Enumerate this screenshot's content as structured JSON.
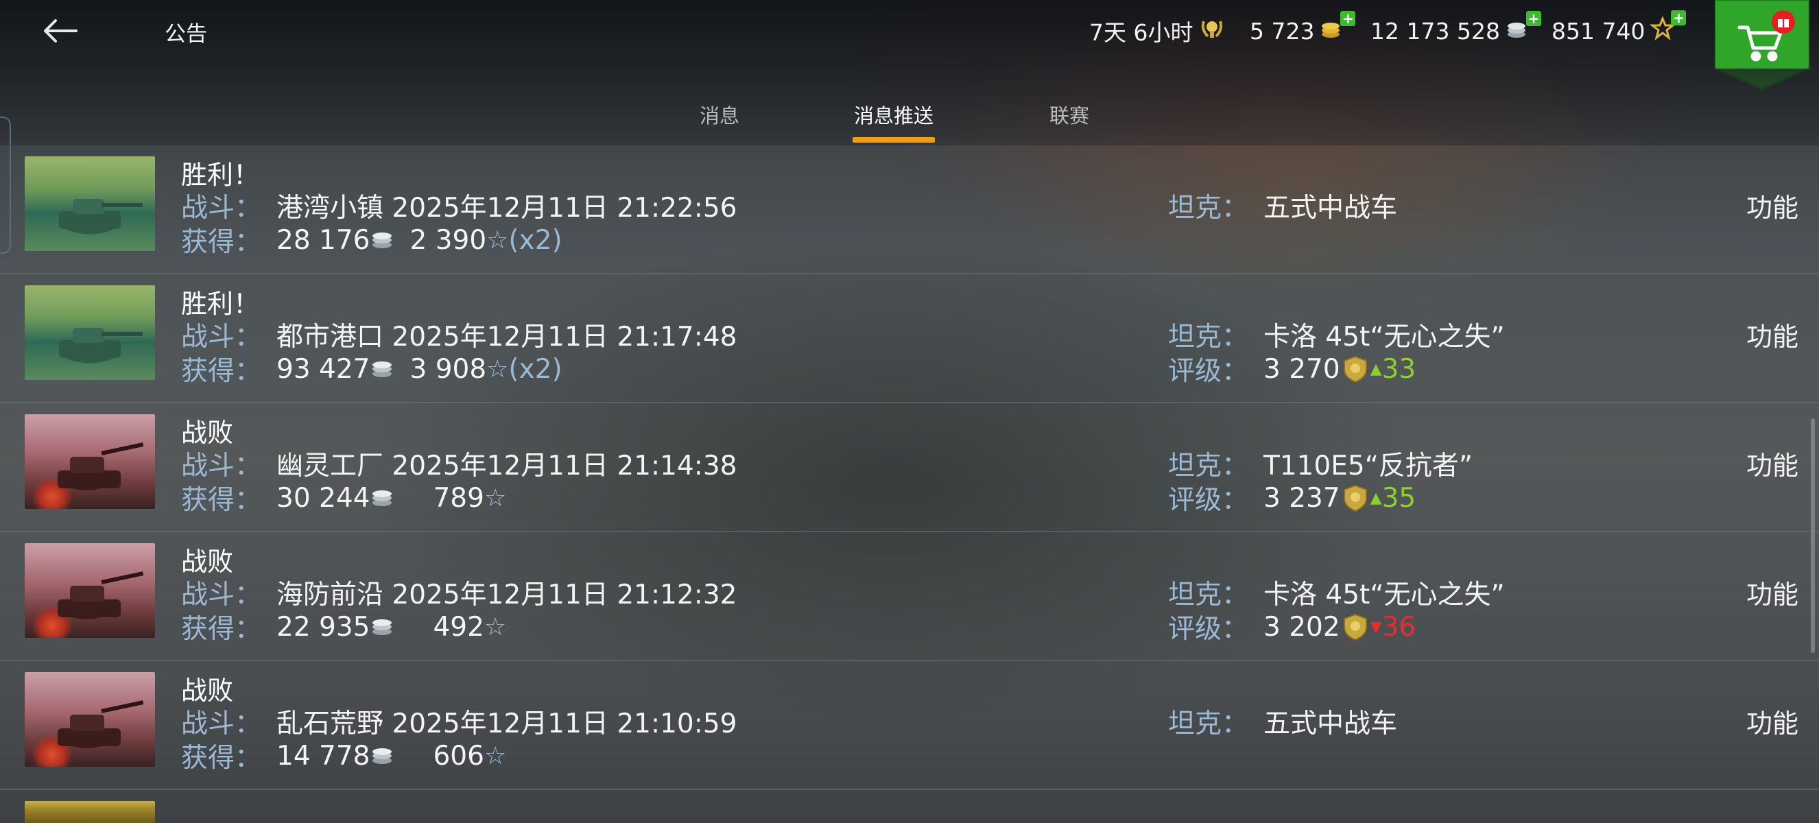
{
  "header": {
    "title": "公告",
    "timer": "7天 6小时",
    "gold": "5 723",
    "credits": "12 173 528",
    "free_xp": "851 740"
  },
  "tabs": [
    {
      "label": "消息",
      "active": false
    },
    {
      "label": "消息推送",
      "active": true
    },
    {
      "label": "联赛",
      "active": false
    }
  ],
  "labels": {
    "battle": "战斗：",
    "earned": "获得：",
    "tank": "坦克：",
    "rating": "评级：",
    "function": "功能"
  },
  "messages": [
    {
      "result": "胜利！",
      "thumb": "win",
      "battle": "港湾小镇 2025年12月11日 21:22:56",
      "credits": "28 176",
      "xp": "2 390",
      "multiplier": "(x2)",
      "tank": "五式中战车",
      "rating": null
    },
    {
      "result": "胜利！",
      "thumb": "win",
      "battle": "都市港口 2025年12月11日 21:17:48",
      "credits": "93 427",
      "xp": "3 908",
      "multiplier": "(x2)",
      "tank": "卡洛 45t“无心之失”",
      "rating": {
        "value": "3 270",
        "delta": "33",
        "direction": "up"
      }
    },
    {
      "result": "战败",
      "thumb": "loss",
      "battle": "幽灵工厂 2025年12月11日 21:14:38",
      "credits": "30 244",
      "xp": "789",
      "multiplier": "",
      "tank": "T110E5“反抗者”",
      "rating": {
        "value": "3 237",
        "delta": "35",
        "direction": "up"
      }
    },
    {
      "result": "战败",
      "thumb": "loss",
      "battle": "海防前沿 2025年12月11日 21:12:32",
      "credits": "22 935",
      "xp": "492",
      "multiplier": "",
      "tank": "卡洛 45t“无心之失”",
      "rating": {
        "value": "3 202",
        "delta": "36",
        "direction": "down"
      }
    },
    {
      "result": "战败",
      "thumb": "loss",
      "battle": "乱石荒野 2025年12月11日 21:10:59",
      "credits": "14 778",
      "xp": "606",
      "multiplier": "",
      "tank": "五式中战车",
      "rating": null
    }
  ],
  "colors": {
    "accent_tab": "#f59b10",
    "label": "#9cb9d4",
    "rating_up": "#8ccf2e",
    "rating_down": "#e03030",
    "shop": "#2fa62a"
  },
  "icons": {
    "back": "arrow-left-icon",
    "timer": "laurel-medal-icon",
    "gold": "gold-coins-icon",
    "credits": "silver-coins-icon",
    "free_xp": "star-icon",
    "shop": "cart-icon",
    "rating": "shield-badge-icon"
  }
}
